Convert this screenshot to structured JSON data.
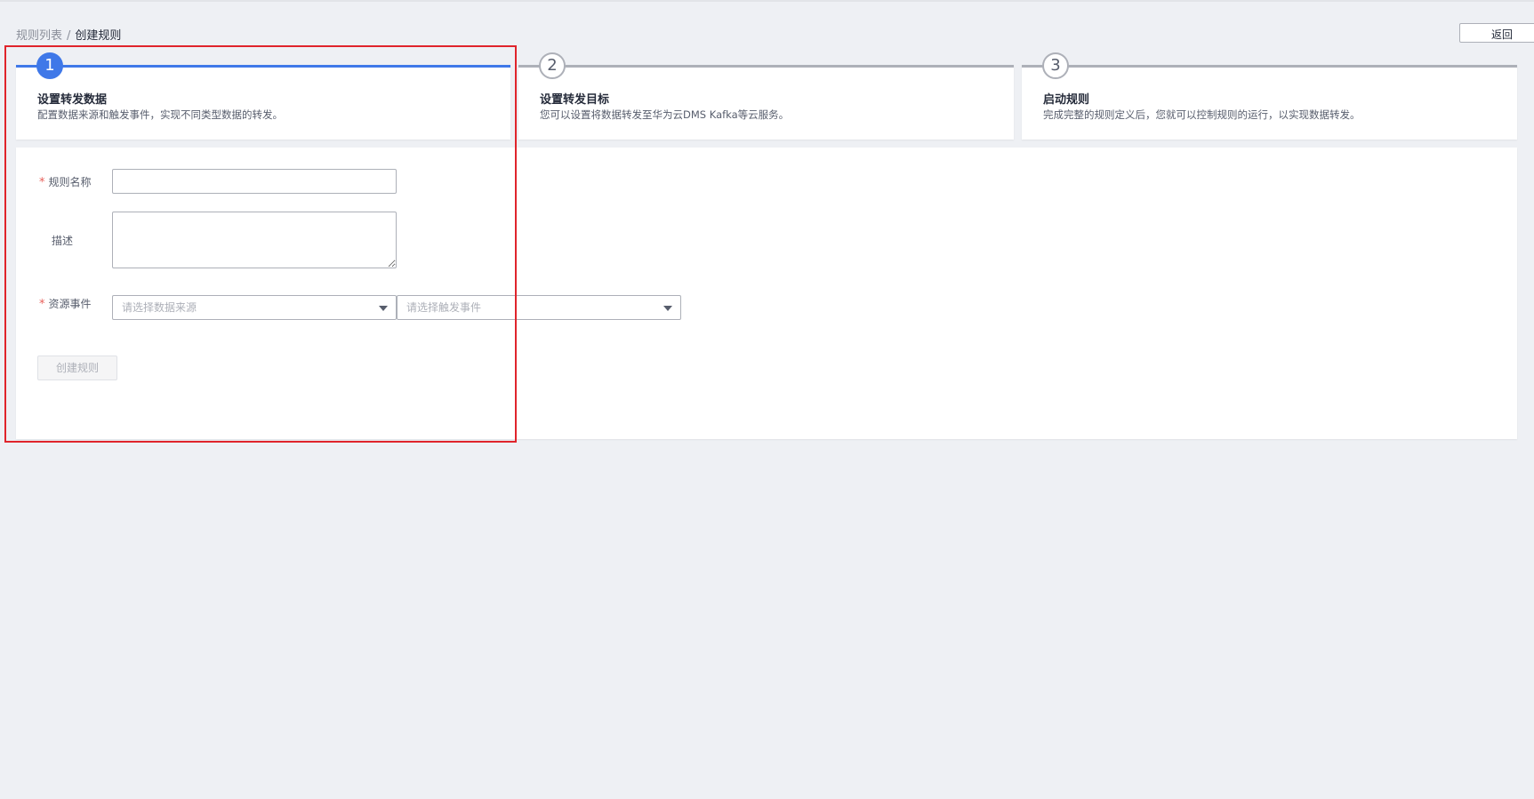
{
  "breadcrumb": {
    "parent": "规则列表",
    "separator": "/",
    "current": "创建规则"
  },
  "header": {
    "back_label": "返回"
  },
  "steps": [
    {
      "number": "1",
      "title": "设置转发数据",
      "description": "配置数据来源和触发事件，实现不同类型数据的转发。",
      "active": true
    },
    {
      "number": "2",
      "title": "设置转发目标",
      "description": "您可以设置将数据转发至华为云DMS Kafka等云服务。",
      "active": false
    },
    {
      "number": "3",
      "title": "启动规则",
      "description": "完成完整的规则定义后，您就可以控制规则的运行，以实现数据转发。",
      "active": false
    }
  ],
  "form": {
    "required_mark": "*",
    "rule_name_label": "规则名称",
    "rule_name_value": "",
    "description_label": "描述",
    "description_value": "",
    "resource_event_label": "资源事件",
    "source_placeholder": "请选择数据来源",
    "trigger_placeholder": "请选择触发事件",
    "create_button": "创建规则"
  },
  "colors": {
    "accent": "#3f78e8",
    "required": "#e8605a",
    "highlight_border": "#e0242b",
    "background": "#eef0f4"
  }
}
